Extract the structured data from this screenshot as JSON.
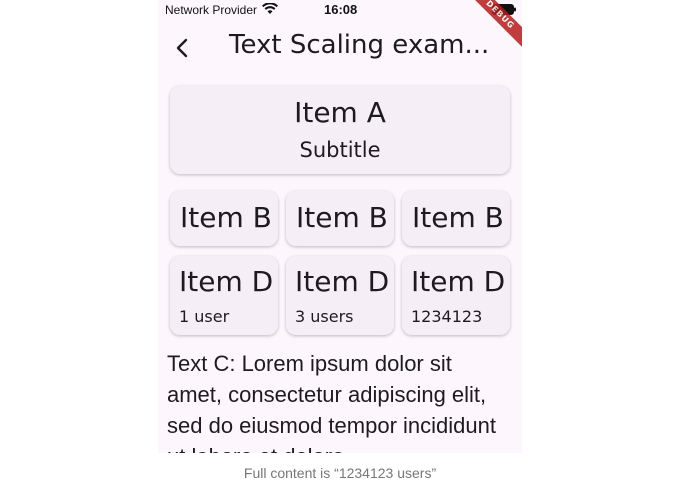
{
  "status_bar": {
    "carrier": "Network Provider",
    "time": "16:08"
  },
  "debug_banner": "DEBUG",
  "app_bar": {
    "title": "Text Scaling exam..."
  },
  "card_a": {
    "title": "Item A",
    "subtitle": "Subtitle"
  },
  "cards_b": [
    {
      "title": "Item B"
    },
    {
      "title": "Item B"
    },
    {
      "title": "Item B"
    }
  ],
  "cards_d": [
    {
      "title": "Item D",
      "subtitle": "1 user"
    },
    {
      "title": "Item D",
      "subtitle": "3 users"
    },
    {
      "title": "Item D",
      "subtitle": "1234123"
    }
  ],
  "text_c": "Text C: Lorem ipsum dolor sit amet, consectetur adipiscing elit, sed do eiusmod tempor incididunt ut labore et dolore",
  "caption": "Full content is “1234123 users”"
}
